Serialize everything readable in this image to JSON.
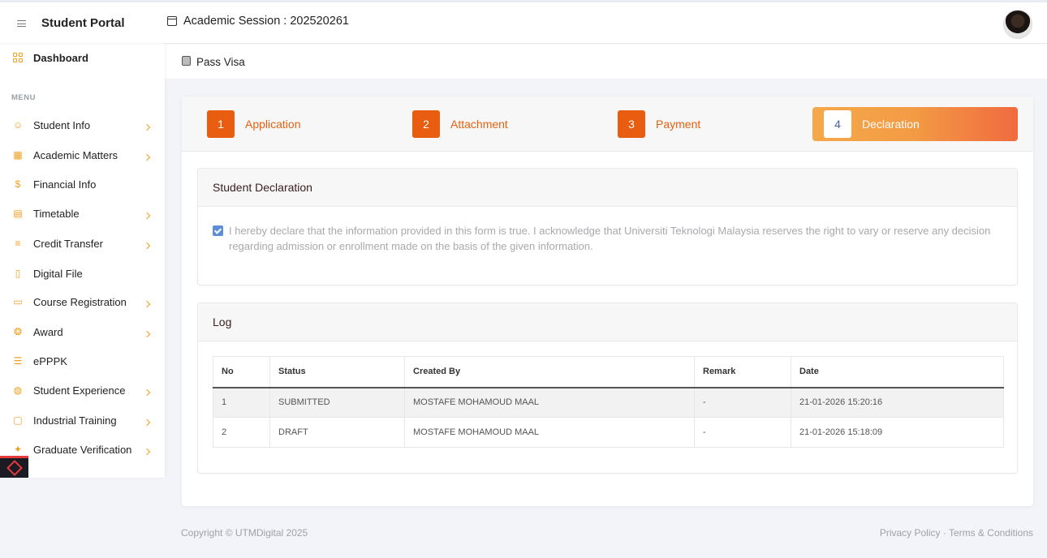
{
  "header": {
    "brand": "Student Portal",
    "session": "Academic Session : 202520261"
  },
  "sidebar": {
    "dashboard": "Dashboard",
    "menu_heading": "MENU",
    "items": [
      {
        "label": "Student Info",
        "icon": "user-icon",
        "chevron": true
      },
      {
        "label": "Academic Matters",
        "icon": "table-icon",
        "chevron": true
      },
      {
        "label": "Financial Info",
        "icon": "dollar-icon",
        "chevron": false
      },
      {
        "label": "Timetable",
        "icon": "calendar-icon",
        "chevron": true
      },
      {
        "label": "Credit Transfer",
        "icon": "file-text-icon",
        "chevron": true
      },
      {
        "label": "Digital File",
        "icon": "file-icon",
        "chevron": false
      },
      {
        "label": "Course Registration",
        "icon": "clipboard-icon",
        "chevron": true
      },
      {
        "label": "Award",
        "icon": "award-icon",
        "chevron": true
      },
      {
        "label": "ePPPK",
        "icon": "list-icon",
        "chevron": false
      },
      {
        "label": "Student Experience",
        "icon": "globe-icon",
        "chevron": true
      },
      {
        "label": "Industrial Training",
        "icon": "monitor-icon",
        "chevron": true
      },
      {
        "label": "Graduate Verification",
        "icon": "puzzle-icon",
        "chevron": true
      }
    ],
    "accent_color": "#f0a020"
  },
  "page": {
    "title": "Pass Visa"
  },
  "steps": [
    {
      "number": "1",
      "label": "Application"
    },
    {
      "number": "2",
      "label": "Attachment"
    },
    {
      "number": "3",
      "label": "Payment"
    },
    {
      "number": "4",
      "label": "Declaration",
      "active": true
    }
  ],
  "declaration": {
    "title": "Student Declaration",
    "checked": true,
    "text": "I hereby declare that the information provided in this form is true. I acknowledge that Universiti Teknologi Malaysia reserves the right to vary or reserve any decision regarding admission or enrollment made on the basis of the given information."
  },
  "log": {
    "title": "Log",
    "columns": [
      "No",
      "Status",
      "Created By",
      "Remark",
      "Date"
    ],
    "rows": [
      [
        "1",
        "SUBMITTED",
        "MOSTAFE MOHAMOUD MAAL",
        "-",
        "21-01-2026 15:20:16"
      ],
      [
        "2",
        "DRAFT",
        "MOSTAFE MOHAMOUD MAAL",
        "-",
        "21-01-2026 15:18:09"
      ]
    ]
  },
  "footer": {
    "copyright": "Copyright © UTMDigital 2025",
    "links": "Privacy Policy · Terms & Conditions"
  }
}
